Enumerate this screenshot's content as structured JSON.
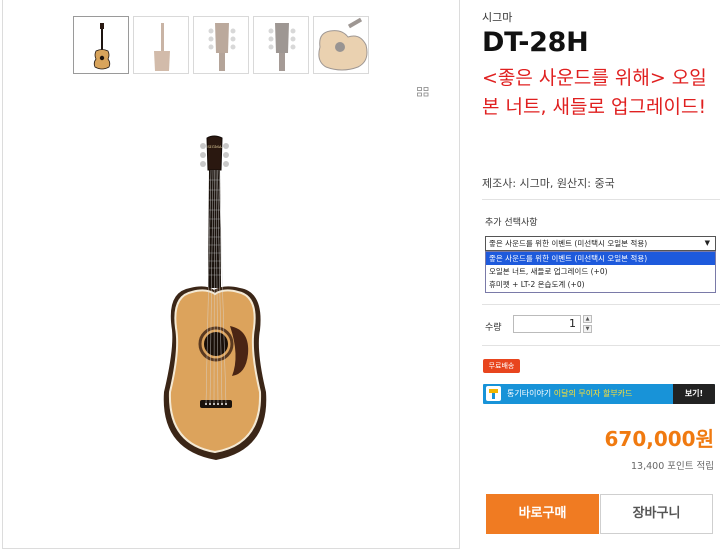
{
  "product": {
    "brand": "시그마",
    "model": "DT-28H",
    "promo": "<좋은 사운드를 위해> 오일본 너트, 새들로 업그레이드!",
    "maker_origin": "제조사: 시그마, 원산지: 중국"
  },
  "gallery": {
    "thumbnails": [
      {
        "label": "front view",
        "active": true
      },
      {
        "label": "side view",
        "active": false
      },
      {
        "label": "headstock back",
        "active": false
      },
      {
        "label": "headstock front",
        "active": false
      },
      {
        "label": "body angle",
        "active": false
      }
    ],
    "zoom_mark": "확대 보기"
  },
  "options": {
    "label": "추가 선택사항",
    "selected": "좋은 사운드를 위한 이벤트 (미선택시 오일본 적용)",
    "items": [
      "좋은 사운드를 위한 이벤트 (미선택시 오일본 적용)",
      "오일본 너트, 새들로 업그레이드 (+0)",
      "휴미펫 + LT-2 온습도계 (+0)"
    ]
  },
  "quantity": {
    "label": "수량",
    "value": "1"
  },
  "badges": {
    "free_shipping": "무료배송"
  },
  "card_banner": {
    "brand": "통기타이야기",
    "text": "이달의 무이자 할부카드",
    "button": "보기!",
    "accent": "#1893d8"
  },
  "pricing": {
    "price": "670,000원",
    "points": "13,400 포인트 적립"
  },
  "actions": {
    "buy": "바로구매",
    "cart": "장바구니"
  },
  "colors": {
    "promo": "#e02020",
    "price": "#f07a10",
    "buy_button": "#f07b22",
    "badge": "#e8451e"
  }
}
